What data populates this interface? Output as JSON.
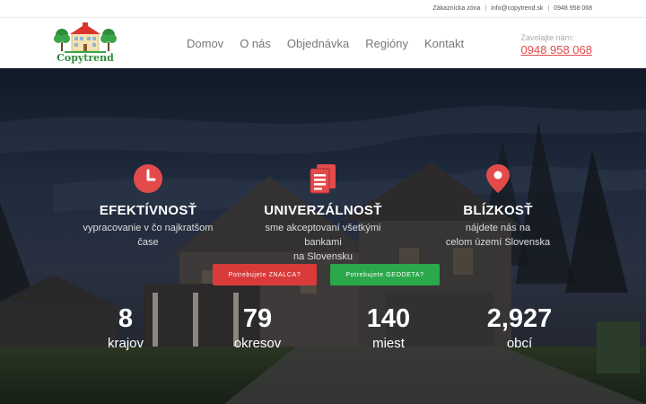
{
  "topbar": {
    "client_zone": "Zákaznícka zóna",
    "email": "info@copytrend.sk",
    "phone": "0948 958 068"
  },
  "header": {
    "logo_text": "Copytrend",
    "nav": [
      "Domov",
      "O nás",
      "Objednávka",
      "Regióny",
      "Kontakt"
    ],
    "cta_label": "Zavolajte nám:",
    "cta_phone": "0948 958 068"
  },
  "features": [
    {
      "icon": "clock-icon",
      "title": "EFEKTÍVNOSŤ",
      "desc1": "vypracovanie v čo najkratšom",
      "desc2": "čase"
    },
    {
      "icon": "documents-icon",
      "title": "UNIVERZÁLNOSŤ",
      "desc1": "sme akceptovaní všetkými bankami",
      "desc2": "na Slovensku"
    },
    {
      "icon": "location-pin-icon",
      "title": "BLÍZKOSŤ",
      "desc1": "nájdete nás na",
      "desc2": "celom území Slovenska"
    }
  ],
  "buttons": {
    "appraiser": "Potrebujete ZNALCA?",
    "surveyor": "Potrebujete GEODETA?"
  },
  "stats": [
    {
      "value": "8",
      "label": "krajov"
    },
    {
      "value": "79",
      "label": "okresov"
    },
    {
      "value": "140",
      "label": "miest"
    },
    {
      "value": "2,927",
      "label": "obcí"
    }
  ],
  "colors": {
    "accent_red": "#e34b4b",
    "button_red": "#d93a3a",
    "button_green": "#2aa84a",
    "logo_green": "#2e8b3a"
  }
}
